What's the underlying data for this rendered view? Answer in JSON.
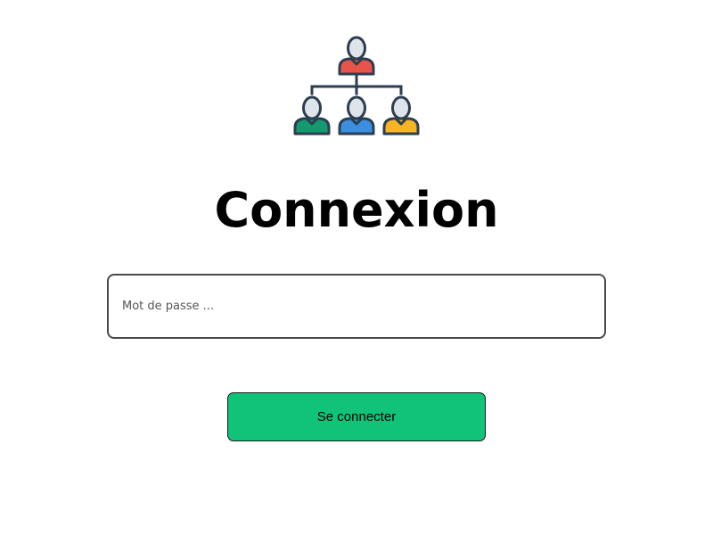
{
  "logo": {
    "icon": "org-chart-icon",
    "colors": {
      "top_person": "#e8534a",
      "left_person": "#139a6e",
      "middle_person": "#3b8ee0",
      "right_person": "#f7b526",
      "outline": "#2d3e50",
      "head": "#dfe4ea"
    }
  },
  "title": "Connexion",
  "password_field": {
    "placeholder": "Mot de passe ...",
    "value": ""
  },
  "login_button": {
    "label": "Se connecter",
    "color": "#11c378"
  }
}
